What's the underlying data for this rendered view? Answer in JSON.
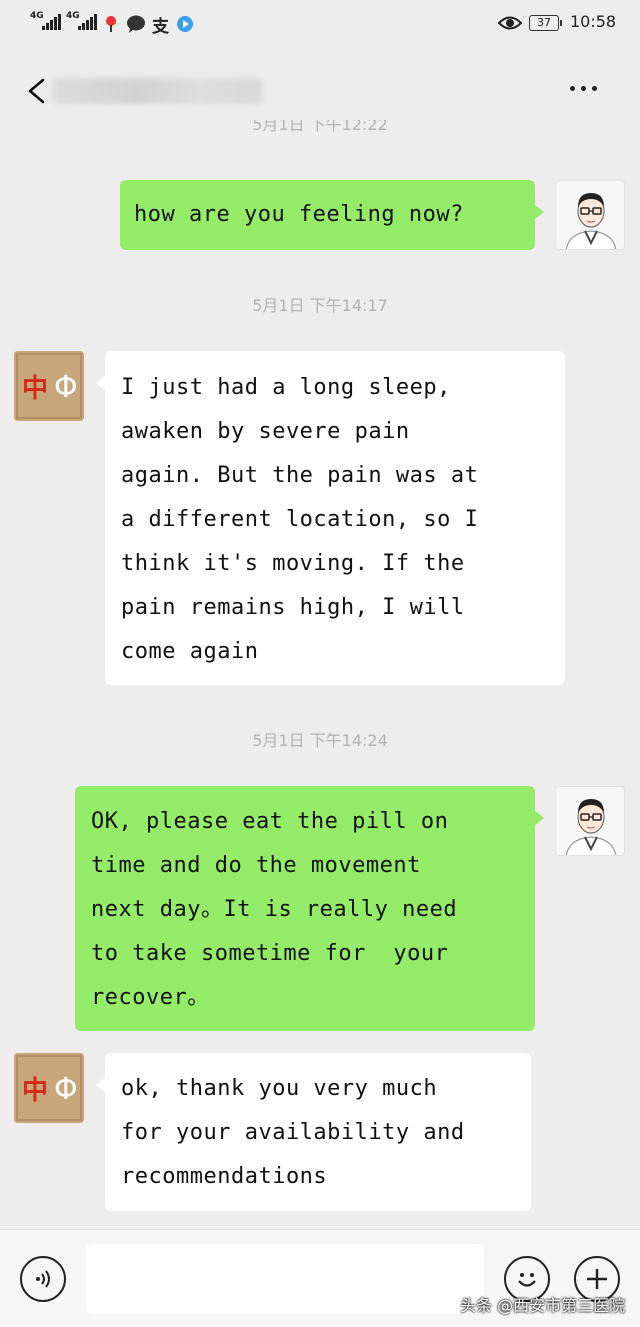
{
  "status_bar": {
    "network_1": "4G",
    "network_2": "4G",
    "battery": "37",
    "time": "10:58",
    "icons": [
      "signal-icon",
      "signal-icon",
      "location-icon",
      "chat-icon",
      "alipay-icon",
      "play-icon",
      "eye-icon",
      "battery-icon"
    ]
  },
  "header": {
    "icons": {
      "back": "chevron-left-icon",
      "more": "more-dots-icon"
    }
  },
  "messages": {
    "ts_top": "5月1日  下午12:22",
    "msg1": "how are you feeling now?",
    "ts1": "5月1日  下午14:17",
    "msg2": "I just had a long sleep,\nawaken by severe pain\nagain. But the pain was at\na different location, so I\nthink it's moving. If the\npain remains high, I will\ncome again",
    "ts2": "5月1日  下午14:24",
    "msg3": "OK, please eat the pill on\ntime and do the movement\nnext day。It is really need\nto take sometime for  your\nrecover。",
    "msg4": "ok, thank you very much\nfor your availability and\nrecommendations",
    "patient_avatar_text": "中Φ"
  },
  "input_bar": {
    "placeholder": "",
    "icons": [
      "voice-icon",
      "emoji-icon",
      "plus-icon"
    ]
  },
  "watermark": "头条 @西安市第三医院",
  "colors": {
    "green_bubble": "#95ec69",
    "background": "#ededed",
    "timestamp": "#b2b2b2"
  }
}
